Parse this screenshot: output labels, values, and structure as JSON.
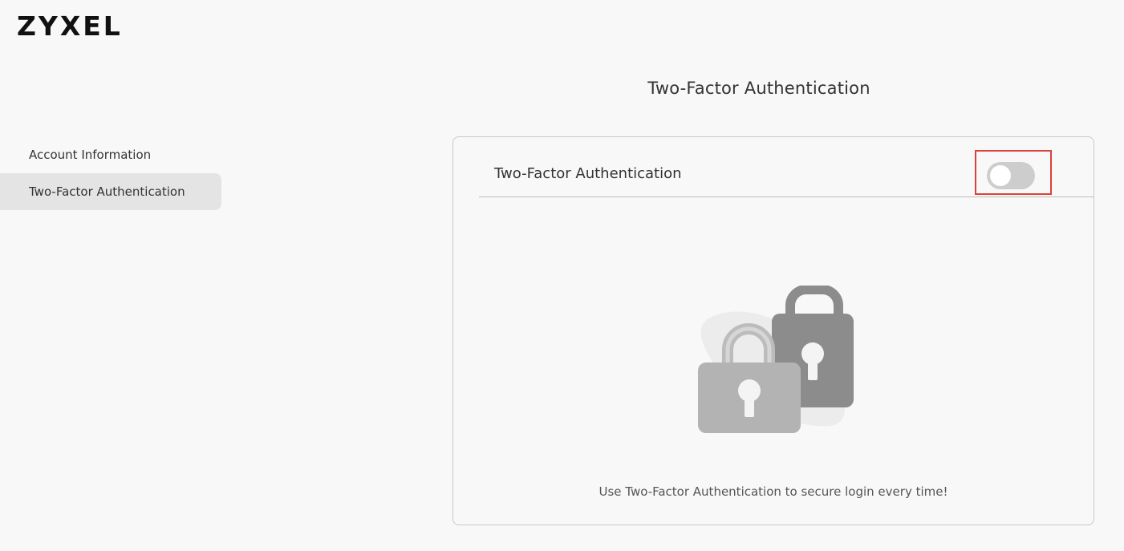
{
  "brand": {
    "logo_text": "ZYXEL"
  },
  "sidebar": {
    "items": [
      {
        "label": "Account Information",
        "active": false
      },
      {
        "label": "Two-Factor Authentication",
        "active": true
      }
    ]
  },
  "main": {
    "title": "Two-Factor Authentication",
    "card": {
      "header_label": "Two-Factor Authentication",
      "toggle_enabled": false,
      "caption": "Use Two-Factor Authentication to secure login every time!"
    }
  },
  "colors": {
    "background": "#f8f8f8",
    "active_item_bg": "#e4e4e4",
    "highlight_border": "#d9433a",
    "toggle_off": "#cdcdcd"
  }
}
